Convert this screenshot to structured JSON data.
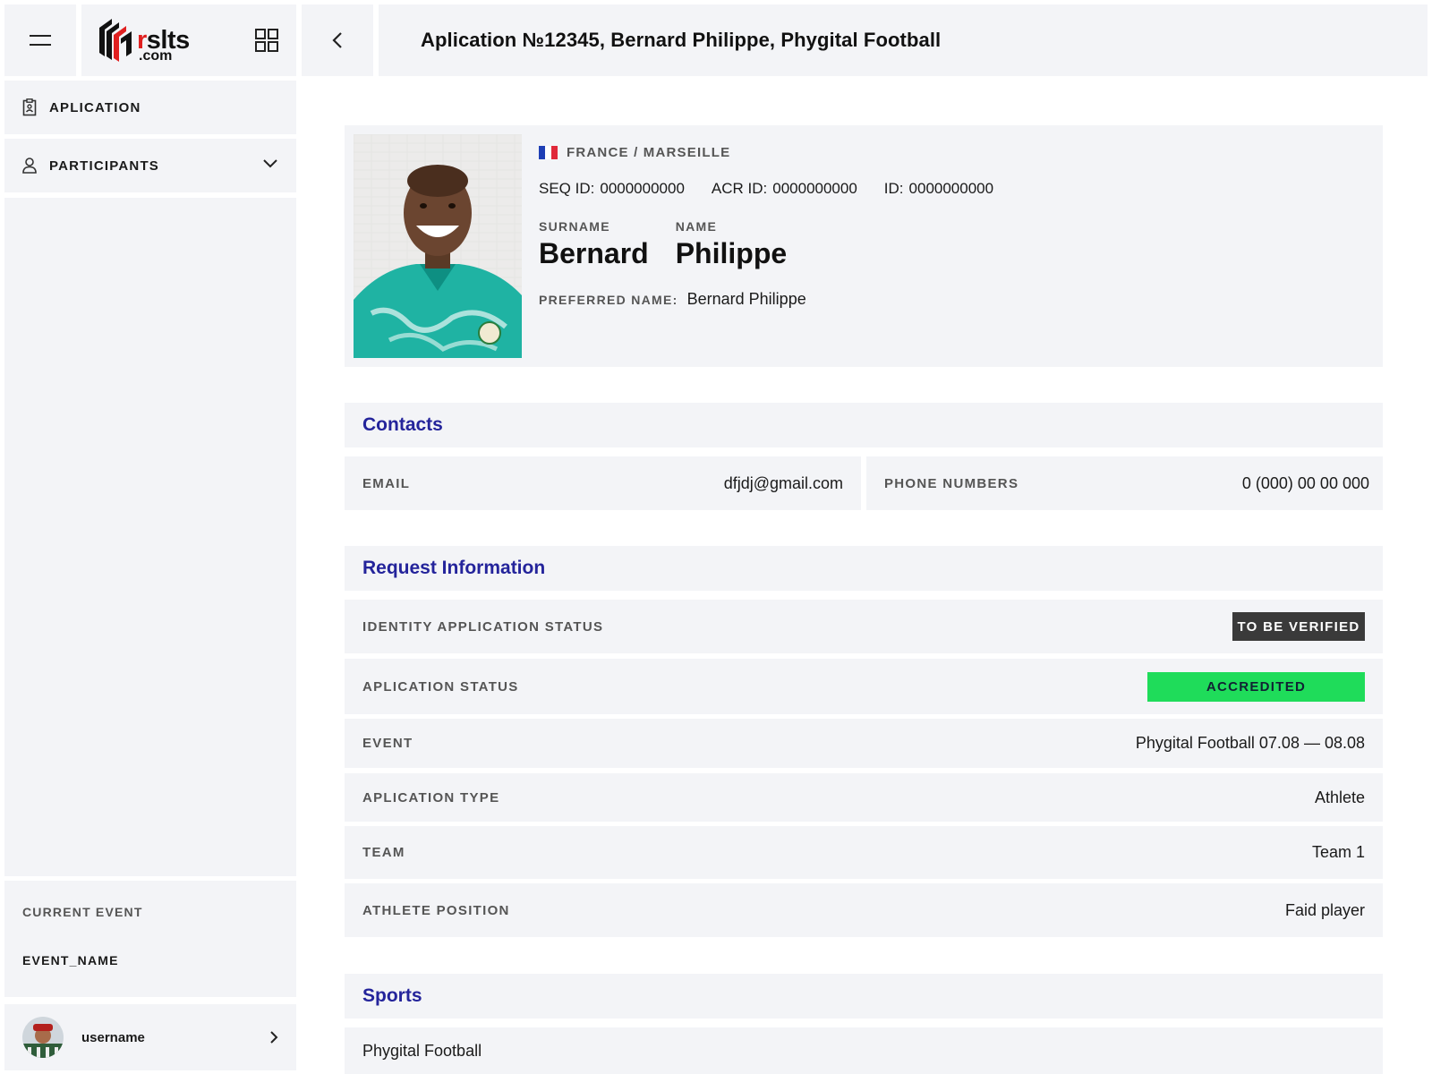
{
  "header": {
    "logo": {
      "main_r": "r",
      "main_rest": "slts",
      "sub": ".com"
    },
    "title": "Aplication №12345, Bernard Philippe, Phygital Football"
  },
  "sidebar": {
    "items": [
      {
        "label": "APLICATION",
        "icon": "clipboard-icon"
      },
      {
        "label": "PARTICIPANTS",
        "icon": "user-icon",
        "expandable": true
      }
    ],
    "current_event": {
      "caption": "CURRENT EVENT",
      "name": "EVENT_NAME"
    },
    "user": {
      "name": "username"
    }
  },
  "profile": {
    "flag_colors": [
      "#1f3fb5",
      "#ffffff",
      "#e0283a"
    ],
    "location": "FRANCE / MARSEILLE",
    "ids": [
      {
        "label": "SEQ ID:",
        "value": "0000000000"
      },
      {
        "label": "ACR ID:",
        "value": "0000000000"
      },
      {
        "label": "ID:",
        "value": "0000000000"
      }
    ],
    "surname_label": "SURNAME",
    "surname": "Bernard",
    "name_label": "NAME",
    "name": "Philippe",
    "preferred_label": "PREFERRED NAME:",
    "preferred": "Bernard Philippe"
  },
  "contacts": {
    "title": "Contacts",
    "email_label": "EMAIL",
    "email": "dfjdj@gmail.com",
    "phone_label": "PHONE NUMBERS",
    "phone": "0 (000) 00 00 000"
  },
  "request": {
    "title": "Request Information",
    "identity_status_label": "IDENTITY APPLICATION STATUS",
    "identity_status": "TO BE VERIFIED",
    "app_status_label": "APLICATION STATUS",
    "app_status": "ACCREDITED",
    "event_label": "EVENT",
    "event": "Phygital Football 07.08 — 08.08",
    "app_type_label": "APLICATION TYPE",
    "app_type": "Athlete",
    "team_label": "TEAM",
    "team": "Team 1",
    "position_label": "ATHLETE POSITION",
    "position": "Faid player"
  },
  "sports": {
    "title": "Sports",
    "items": [
      "Phygital Football"
    ]
  },
  "colors": {
    "tile_bg": "#f3f4f7",
    "section_title": "#24249b",
    "accredited_green": "#1fdc5a",
    "verify_dark": "#3a3a3a",
    "logo_red": "#e02020"
  }
}
